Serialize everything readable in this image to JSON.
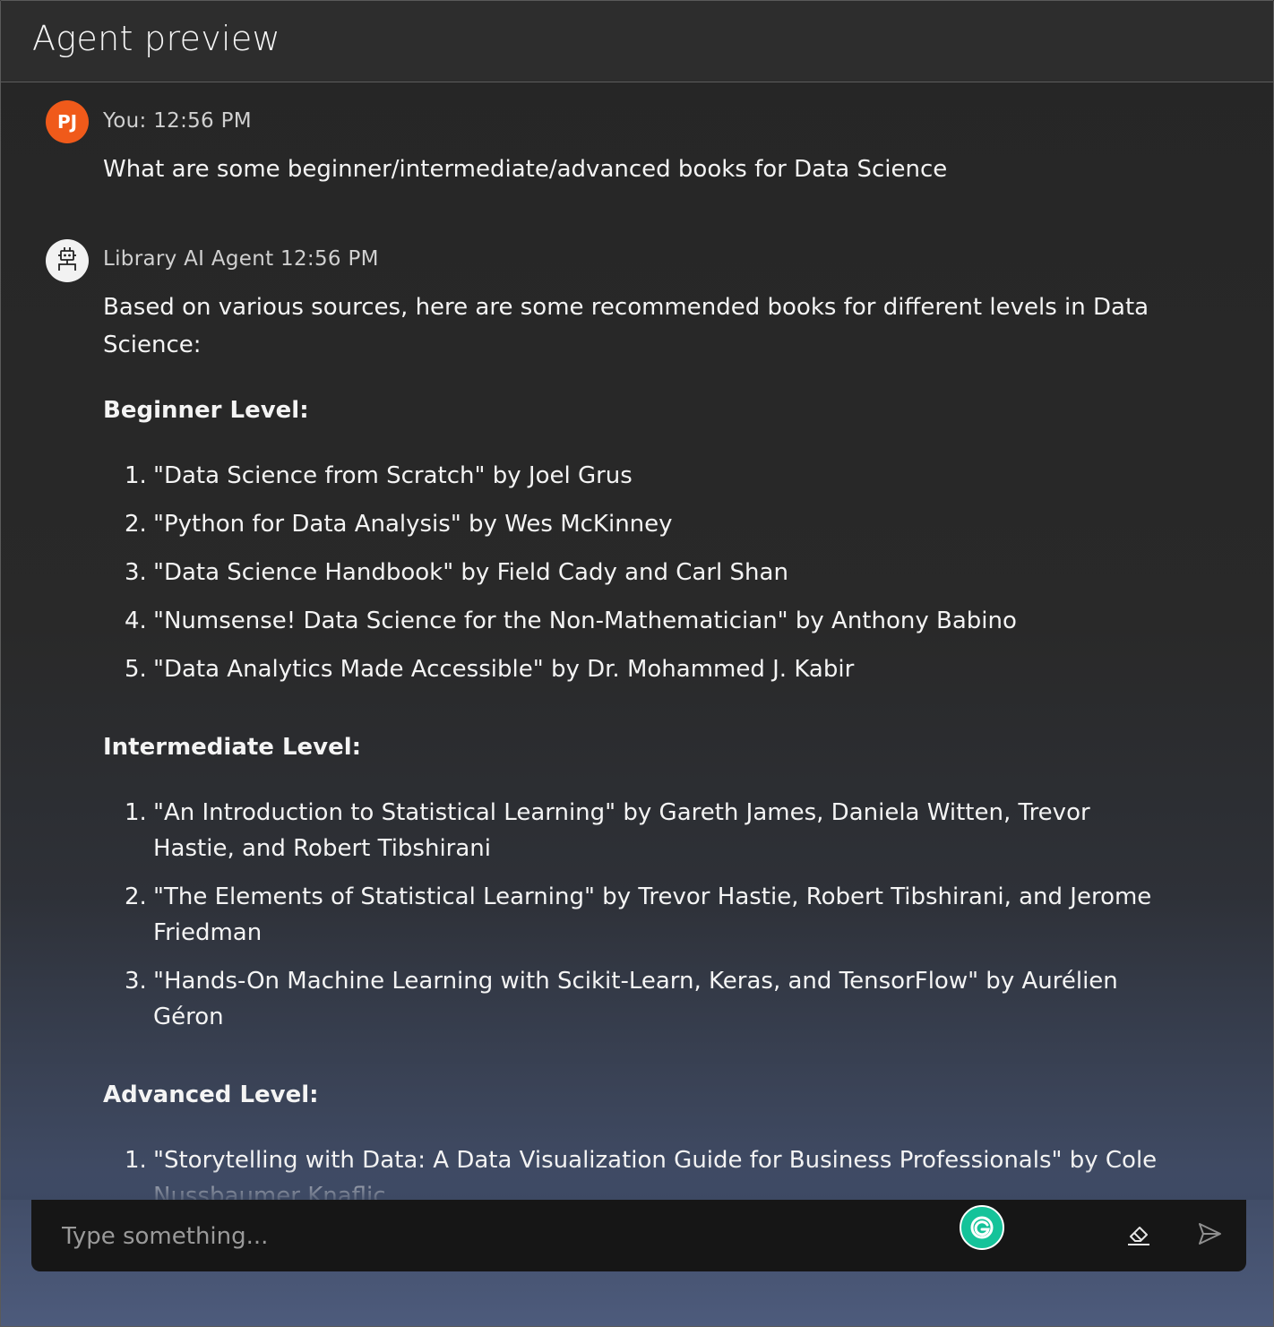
{
  "header": {
    "title": "Agent preview"
  },
  "messages": {
    "user": {
      "avatar_initials": "PJ",
      "meta": "You: 12:56 PM",
      "text": "What are some beginner/intermediate/advanced books for Data Science"
    },
    "agent": {
      "meta": "Library AI Agent 12:56 PM",
      "intro": "Based on various sources, here are some recommended books for different levels in Data Science:",
      "sections": [
        {
          "title": "Beginner Level:",
          "items": [
            "\"Data Science from Scratch\" by Joel Grus",
            "\"Python for Data Analysis\" by Wes McKinney",
            "\"Data Science Handbook\" by Field Cady and Carl Shan",
            "\"Numsense! Data Science for the Non-Mathematician\" by Anthony Babino",
            "\"Data Analytics Made Accessible\" by Dr. Mohammed J. Kabir"
          ]
        },
        {
          "title": "Intermediate Level:",
          "items": [
            "\"An Introduction to Statistical Learning\" by Gareth James, Daniela Witten, Trevor Hastie, and Robert Tibshirani",
            "\"The Elements of Statistical Learning\" by Trevor Hastie, Robert Tibshirani, and Jerome Friedman",
            "\"Hands-On Machine Learning with Scikit-Learn, Keras, and TensorFlow\" by Aurélien Géron"
          ]
        },
        {
          "title": "Advanced Level:",
          "items": [
            "\"Storytelling with Data: A Data Visualization Guide for Business Professionals\" by Cole Nussbaumer Knaflic"
          ]
        }
      ]
    }
  },
  "input": {
    "placeholder": "Type something..."
  },
  "icons": {
    "bot_avatar": "robot-icon",
    "grammarly": "grammarly-icon",
    "clear": "eraser-icon",
    "send": "send-icon"
  },
  "colors": {
    "user_avatar": "#f05a1a",
    "grammarly": "#15c39a"
  }
}
